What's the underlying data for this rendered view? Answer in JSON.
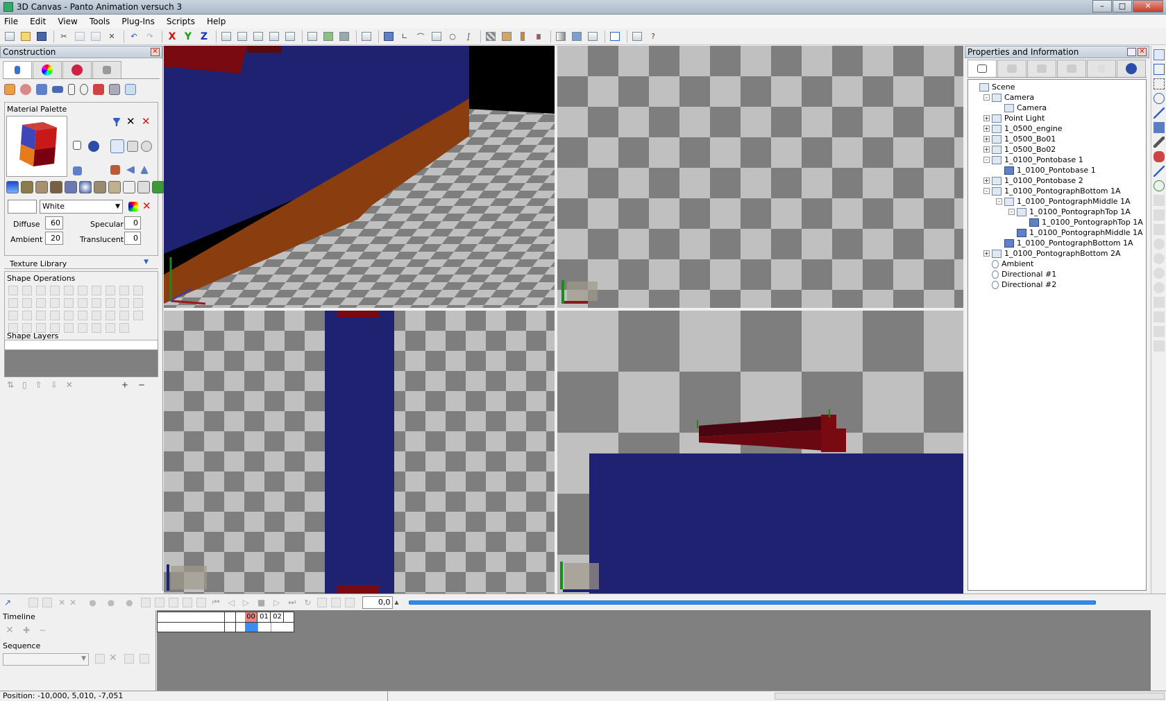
{
  "window": {
    "title": "3D Canvas - Panto Animation versuch 3"
  },
  "menu": [
    "File",
    "Edit",
    "View",
    "Tools",
    "Plug-Ins",
    "Scripts",
    "Help"
  ],
  "construction": {
    "title": "Construction",
    "material_palette": "Material Palette",
    "material_name": "White",
    "diffuse_label": "Diffuse",
    "diffuse_value": "60",
    "specular_label": "Specular",
    "specular_value": "0",
    "ambient_label": "Ambient",
    "ambient_value": "20",
    "translucent_label": "Translucent",
    "translucent_value": "0",
    "texture_library": "Texture Library",
    "shape_operations": "Shape Operations",
    "shape_layers": "Shape Layers"
  },
  "properties": {
    "title": "Properties and Information",
    "tree": [
      {
        "label": "Scene",
        "indent": 0,
        "icon": "scene",
        "expander": ""
      },
      {
        "label": "Camera",
        "indent": 1,
        "icon": "group",
        "expander": "-"
      },
      {
        "label": "Camera",
        "indent": 2,
        "icon": "camera",
        "expander": ""
      },
      {
        "label": "Point Light",
        "indent": 1,
        "icon": "group",
        "expander": "+"
      },
      {
        "label": "1_0500_engine",
        "indent": 1,
        "icon": "group",
        "expander": "+"
      },
      {
        "label": "1_0500_Bo01",
        "indent": 1,
        "icon": "group",
        "expander": "+"
      },
      {
        "label": "1_0500_Bo02",
        "indent": 1,
        "icon": "group",
        "expander": "+"
      },
      {
        "label": "1_0100_Pontobase 1",
        "indent": 1,
        "icon": "group",
        "expander": "-"
      },
      {
        "label": "1_0100_Pontobase 1",
        "indent": 2,
        "icon": "cube",
        "expander": ""
      },
      {
        "label": "1_0100_Pontobase 2",
        "indent": 1,
        "icon": "group",
        "expander": "+"
      },
      {
        "label": "1_0100_PontographBottom 1A",
        "indent": 1,
        "icon": "group",
        "expander": "-"
      },
      {
        "label": "1_0100_PontographMiddle 1A",
        "indent": 2,
        "icon": "group",
        "expander": "-"
      },
      {
        "label": "1_0100_PontographTop 1A",
        "indent": 3,
        "icon": "group",
        "expander": "-"
      },
      {
        "label": "1_0100_PontographTop 1A",
        "indent": 4,
        "icon": "cube",
        "expander": ""
      },
      {
        "label": "1_0100_PontographMiddle 1A",
        "indent": 3,
        "icon": "cube",
        "expander": ""
      },
      {
        "label": "1_0100_PontographBottom 1A",
        "indent": 2,
        "icon": "cube",
        "expander": ""
      },
      {
        "label": "1_0100_PontographBottom 2A",
        "indent": 1,
        "icon": "group",
        "expander": "+"
      },
      {
        "label": "Ambient",
        "indent": 1,
        "icon": "bulb",
        "expander": ""
      },
      {
        "label": "Directional #1",
        "indent": 1,
        "icon": "bulb",
        "expander": ""
      },
      {
        "label": "Directional #2",
        "indent": 1,
        "icon": "bulb",
        "expander": ""
      }
    ]
  },
  "timeline": {
    "label": "Timeline",
    "sequence_label": "Sequence",
    "time_value": "0,0",
    "frames": [
      "00",
      "01",
      "02"
    ]
  },
  "status": {
    "position": "Position: -10,000, 5,010, -7,051"
  },
  "colors": {
    "hull_blue": "#1f2270",
    "arm_red": "#7a0a12",
    "check_dark": "#7e7e7e",
    "check_light": "#c0c0c0",
    "orange_trim": "#8a3e10"
  }
}
